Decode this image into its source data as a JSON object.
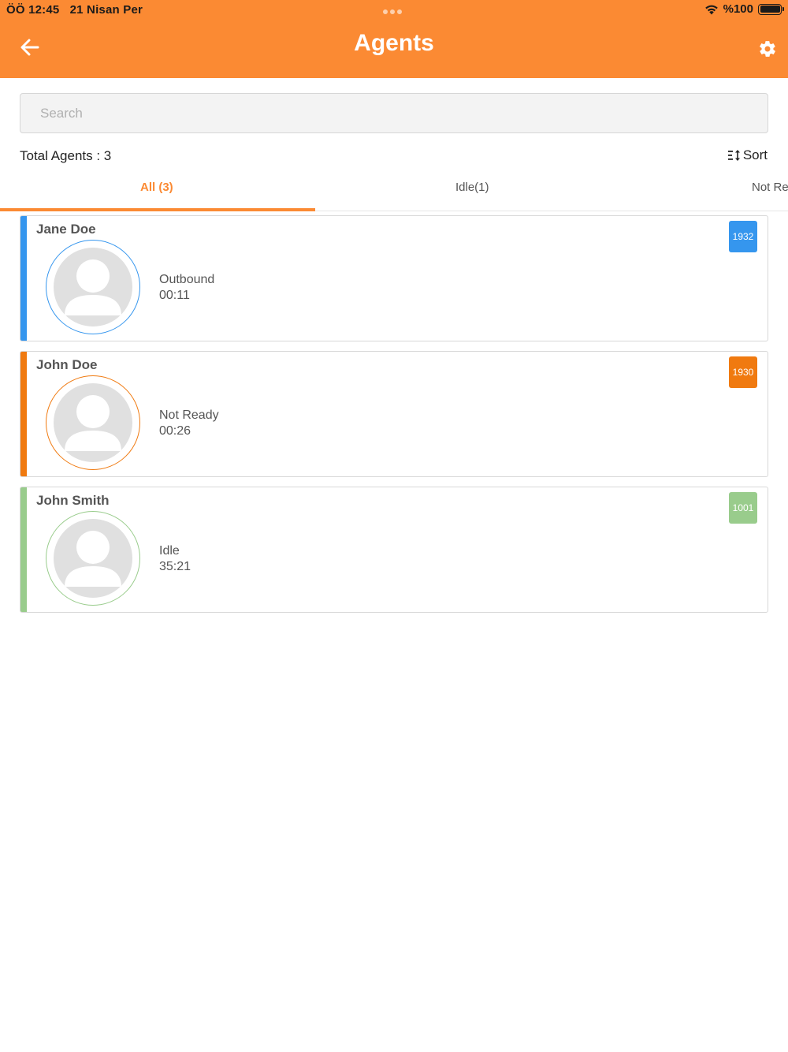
{
  "status_bar": {
    "time": "ÖÖ 12:45",
    "date": "21 Nisan Per",
    "battery": "%100"
  },
  "header": {
    "title": "Agents",
    "color": "#fb8a33"
  },
  "search": {
    "placeholder": "Search",
    "value": ""
  },
  "summary": {
    "total_label": "Total Agents : 3",
    "sort_label": "Sort"
  },
  "tabs": [
    {
      "label": "All (3)",
      "active": true
    },
    {
      "label": "Idle(1)",
      "active": false
    },
    {
      "label": "Not Re",
      "active": false
    }
  ],
  "agents": [
    {
      "name": "Jane Doe",
      "status": "Outbound",
      "duration": "00:11",
      "extension": "1932",
      "color": "#3596ee"
    },
    {
      "name": "John Doe",
      "status": "Not Ready",
      "duration": "00:26",
      "extension": "1930",
      "color": "#f07a10"
    },
    {
      "name": "John Smith",
      "status": "Idle",
      "duration": "35:21",
      "extension": "1001",
      "color": "#99cc8c"
    }
  ],
  "icons": {
    "back": "arrow-left-icon",
    "settings": "gear-icon",
    "sort": "sort-icon",
    "wifi": "wifi-icon",
    "battery": "battery-icon",
    "avatar": "person-icon"
  }
}
